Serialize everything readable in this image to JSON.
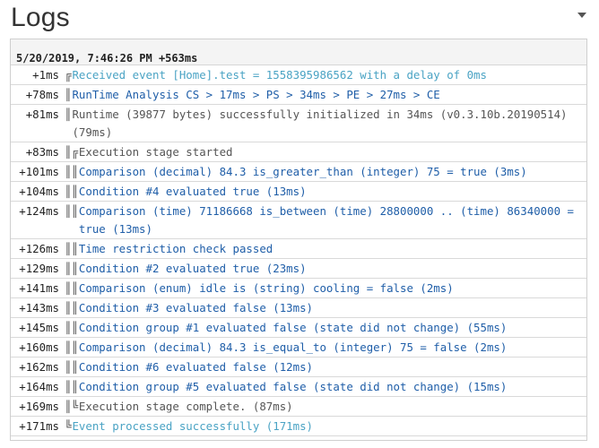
{
  "header": {
    "title": "Logs"
  },
  "panel": {
    "timestamp": "5/20/2019, 7:46:26 PM +563ms",
    "rows": [
      {
        "delta": "+1ms",
        "tree": "╔",
        "msg": "Received event [Home].test = 1558395986562 with a delay of 0ms",
        "tone": "light"
      },
      {
        "delta": "+78ms",
        "tree": "║",
        "msg": "RunTime Analysis CS > 17ms > PS > 34ms > PE > 27ms > CE",
        "tone": "blue"
      },
      {
        "delta": "+81ms",
        "tree": "║",
        "msg": "Runtime (39877 bytes) successfully initialized in 34ms (v0.3.10b.20190514) (79ms)",
        "tone": "dark"
      },
      {
        "delta": "+83ms",
        "tree": "║╔",
        "msg": "Execution stage started",
        "tone": "dark"
      },
      {
        "delta": "+101ms",
        "tree": "║║",
        "msg": "Comparison (decimal) 84.3 is_greater_than (integer) 75 = true (3ms)",
        "tone": "blue"
      },
      {
        "delta": "+104ms",
        "tree": "║║",
        "msg": "Condition #4 evaluated true (13ms)",
        "tone": "blue"
      },
      {
        "delta": "+124ms",
        "tree": "║║",
        "msg": "Comparison (time) 71186668 is_between (time) 28800000 .. (time) 86340000 = true (13ms)",
        "tone": "blue"
      },
      {
        "delta": "+126ms",
        "tree": "║║",
        "msg": "Time restriction check passed",
        "tone": "blue"
      },
      {
        "delta": "+129ms",
        "tree": "║║",
        "msg": "Condition #2 evaluated true (23ms)",
        "tone": "blue"
      },
      {
        "delta": "+141ms",
        "tree": "║║",
        "msg": "Comparison (enum) idle is (string) cooling = false (2ms)",
        "tone": "blue"
      },
      {
        "delta": "+143ms",
        "tree": "║║",
        "msg": "Condition #3 evaluated false (13ms)",
        "tone": "blue"
      },
      {
        "delta": "+145ms",
        "tree": "║║",
        "msg": "Condition group #1 evaluated false (state did not change) (55ms)",
        "tone": "blue"
      },
      {
        "delta": "+160ms",
        "tree": "║║",
        "msg": "Comparison (decimal) 84.3 is_equal_to (integer) 75 = false (2ms)",
        "tone": "blue"
      },
      {
        "delta": "+162ms",
        "tree": "║║",
        "msg": "Condition #6 evaluated false (12ms)",
        "tone": "blue"
      },
      {
        "delta": "+164ms",
        "tree": "║║",
        "msg": "Condition group #5 evaluated false (state did not change) (15ms)",
        "tone": "blue"
      },
      {
        "delta": "+169ms",
        "tree": "║╚",
        "msg": "Execution stage complete. (87ms)",
        "tone": "dark"
      },
      {
        "delta": "+171ms",
        "tree": "╚",
        "msg": "Event processed successfully (171ms)",
        "tone": "light"
      }
    ]
  },
  "colors": {
    "blue": "#1f5ea8",
    "dark": "#555555",
    "light": "#4aa3c4"
  },
  "icons": {
    "collapse": "chevron-down-icon"
  }
}
